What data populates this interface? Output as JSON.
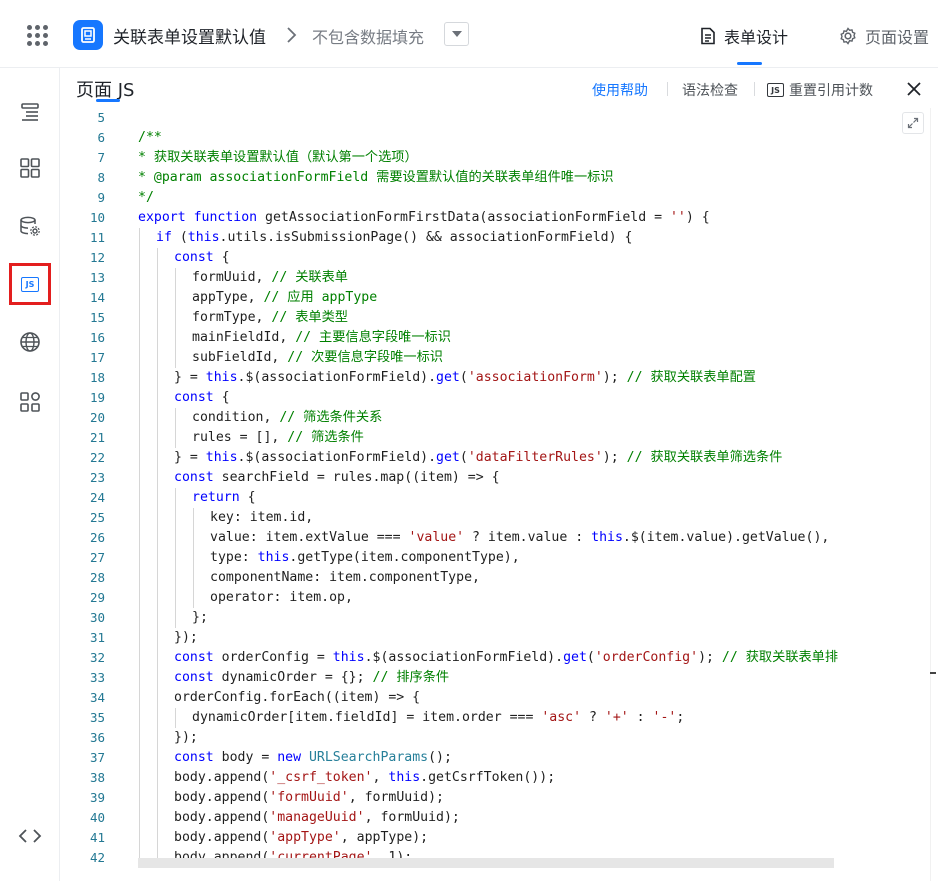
{
  "topbar": {
    "app_title": "关联表单设置默认值",
    "sub_title": "不包含数据填充",
    "nav_form": "表单设计",
    "nav_page": "页面设置"
  },
  "panel": {
    "title": "页面 JS",
    "help": "使用帮助",
    "lint": "语法检查",
    "reset": "重置引用计数",
    "js_badge": "JS"
  },
  "rail": {
    "js_badge": "JS"
  },
  "editor": {
    "lines": [
      {
        "n": "5",
        "indent": 0,
        "guides": [],
        "tokens": [
          [
            "",
            ""
          ]
        ]
      },
      {
        "n": "6",
        "indent": 0,
        "guides": [],
        "tokens": [
          [
            "cm",
            "/**"
          ]
        ]
      },
      {
        "n": "7",
        "indent": 0,
        "guides": [],
        "tokens": [
          [
            "cm",
            "* 获取关联表单设置默认值（默认第一个选项）"
          ]
        ]
      },
      {
        "n": "8",
        "indent": 0,
        "guides": [],
        "tokens": [
          [
            "cm",
            "* @param associationFormField 需要设置默认值的关联表单组件唯一标识"
          ]
        ]
      },
      {
        "n": "9",
        "indent": 0,
        "guides": [],
        "tokens": [
          [
            "cm",
            "*/"
          ]
        ]
      },
      {
        "n": "10",
        "indent": 0,
        "guides": [],
        "tokens": [
          [
            "kw",
            "export "
          ],
          [
            "kw",
            "function "
          ],
          [
            "fn",
            "getAssociationFormFirstData(associationFormField = "
          ],
          [
            "str",
            "''"
          ],
          [
            "fn",
            ") {"
          ]
        ]
      },
      {
        "n": "11",
        "indent": 1,
        "guides": [
          1
        ],
        "tokens": [
          [
            "kw",
            "if "
          ],
          [
            "fn",
            "("
          ],
          [
            "kw",
            "this"
          ],
          [
            "fn",
            ".utils.isSubmissionPage() && associationFormField) {"
          ]
        ]
      },
      {
        "n": "12",
        "indent": 2,
        "guides": [
          1,
          2
        ],
        "tokens": [
          [
            "kw",
            "const "
          ],
          [
            "fn",
            "{"
          ]
        ]
      },
      {
        "n": "13",
        "indent": 3,
        "guides": [
          1,
          2,
          3
        ],
        "tokens": [
          [
            "fn",
            "formUuid, "
          ],
          [
            "cm",
            "// 关联表单"
          ]
        ]
      },
      {
        "n": "14",
        "indent": 3,
        "guides": [
          1,
          2,
          3
        ],
        "tokens": [
          [
            "fn",
            "appType, "
          ],
          [
            "cm",
            "// 应用 appType"
          ]
        ]
      },
      {
        "n": "15",
        "indent": 3,
        "guides": [
          1,
          2,
          3
        ],
        "tokens": [
          [
            "fn",
            "formType, "
          ],
          [
            "cm",
            "// 表单类型"
          ]
        ]
      },
      {
        "n": "16",
        "indent": 3,
        "guides": [
          1,
          2,
          3
        ],
        "tokens": [
          [
            "fn",
            "mainFieldId, "
          ],
          [
            "cm",
            "// 主要信息字段唯一标识"
          ]
        ]
      },
      {
        "n": "17",
        "indent": 3,
        "guides": [
          1,
          2,
          3
        ],
        "tokens": [
          [
            "fn",
            "subFieldId, "
          ],
          [
            "cm",
            "// 次要信息字段唯一标识"
          ]
        ]
      },
      {
        "n": "18",
        "indent": 2,
        "guides": [
          1,
          2
        ],
        "tokens": [
          [
            "fn",
            "} = "
          ],
          [
            "kw",
            "this"
          ],
          [
            "fn",
            ".$(associationFormField)."
          ],
          [
            "kw",
            "get"
          ],
          [
            "fn",
            "("
          ],
          [
            "str",
            "'associationForm'"
          ],
          [
            "fn",
            "); "
          ],
          [
            "cm",
            "// 获取关联表单配置"
          ]
        ]
      },
      {
        "n": "19",
        "indent": 2,
        "guides": [
          1,
          2
        ],
        "tokens": [
          [
            "kw",
            "const "
          ],
          [
            "fn",
            "{"
          ]
        ]
      },
      {
        "n": "20",
        "indent": 3,
        "guides": [
          1,
          2,
          3
        ],
        "tokens": [
          [
            "fn",
            "condition, "
          ],
          [
            "cm",
            "// 筛选条件关系"
          ]
        ]
      },
      {
        "n": "21",
        "indent": 3,
        "guides": [
          1,
          2,
          3
        ],
        "tokens": [
          [
            "fn",
            "rules = [], "
          ],
          [
            "cm",
            "// 筛选条件"
          ]
        ]
      },
      {
        "n": "22",
        "indent": 2,
        "guides": [
          1,
          2
        ],
        "tokens": [
          [
            "fn",
            "} = "
          ],
          [
            "kw",
            "this"
          ],
          [
            "fn",
            ".$(associationFormField)."
          ],
          [
            "kw",
            "get"
          ],
          [
            "fn",
            "("
          ],
          [
            "str",
            "'dataFilterRules'"
          ],
          [
            "fn",
            "); "
          ],
          [
            "cm",
            "// 获取关联表单筛选条件"
          ]
        ]
      },
      {
        "n": "23",
        "indent": 2,
        "guides": [
          1,
          2
        ],
        "tokens": [
          [
            "kw",
            "const "
          ],
          [
            "fn",
            "searchField = rules.map((item) => {"
          ]
        ]
      },
      {
        "n": "24",
        "indent": 3,
        "guides": [
          1,
          2,
          3
        ],
        "tokens": [
          [
            "kw",
            "return "
          ],
          [
            "fn",
            "{"
          ]
        ]
      },
      {
        "n": "25",
        "indent": 4,
        "guides": [
          1,
          2,
          3,
          4
        ],
        "tokens": [
          [
            "fn",
            "key: item.id,"
          ]
        ]
      },
      {
        "n": "26",
        "indent": 4,
        "guides": [
          1,
          2,
          3,
          4
        ],
        "tokens": [
          [
            "fn",
            "value: item.extValue === "
          ],
          [
            "str",
            "'value'"
          ],
          [
            "fn",
            " ? item.value : "
          ],
          [
            "kw",
            "this"
          ],
          [
            "fn",
            ".$(item.value).getValue(),"
          ]
        ]
      },
      {
        "n": "27",
        "indent": 4,
        "guides": [
          1,
          2,
          3,
          4
        ],
        "tokens": [
          [
            "fn",
            "type: "
          ],
          [
            "kw",
            "this"
          ],
          [
            "fn",
            ".getType(item.componentType),"
          ]
        ]
      },
      {
        "n": "28",
        "indent": 4,
        "guides": [
          1,
          2,
          3,
          4
        ],
        "tokens": [
          [
            "fn",
            "componentName: item.componentType,"
          ]
        ]
      },
      {
        "n": "29",
        "indent": 4,
        "guides": [
          1,
          2,
          3,
          4
        ],
        "tokens": [
          [
            "fn",
            "operator: item.op,"
          ]
        ]
      },
      {
        "n": "30",
        "indent": 3,
        "guides": [
          1,
          2,
          3
        ],
        "tokens": [
          [
            "fn",
            "};"
          ]
        ]
      },
      {
        "n": "31",
        "indent": 2,
        "guides": [
          1,
          2
        ],
        "tokens": [
          [
            "fn",
            "});"
          ]
        ]
      },
      {
        "n": "32",
        "indent": 2,
        "guides": [
          1,
          2
        ],
        "tokens": [
          [
            "kw",
            "const "
          ],
          [
            "fn",
            "orderConfig = "
          ],
          [
            "kw",
            "this"
          ],
          [
            "fn",
            ".$(associationFormField)."
          ],
          [
            "kw",
            "get"
          ],
          [
            "fn",
            "("
          ],
          [
            "str",
            "'orderConfig'"
          ],
          [
            "fn",
            "); "
          ],
          [
            "cm",
            "// 获取关联表单排"
          ]
        ]
      },
      {
        "n": "33",
        "indent": 2,
        "guides": [
          1,
          2
        ],
        "tokens": [
          [
            "kw",
            "const "
          ],
          [
            "fn",
            "dynamicOrder = {}; "
          ],
          [
            "cm",
            "// 排序条件"
          ]
        ]
      },
      {
        "n": "34",
        "indent": 2,
        "guides": [
          1,
          2
        ],
        "tokens": [
          [
            "fn",
            "orderConfig.forEach((item) => {"
          ]
        ]
      },
      {
        "n": "35",
        "indent": 3,
        "guides": [
          1,
          2,
          3
        ],
        "tokens": [
          [
            "fn",
            "dynamicOrder[item.fieldId] = item.order === "
          ],
          [
            "str",
            "'asc'"
          ],
          [
            "fn",
            " ? "
          ],
          [
            "str",
            "'+'"
          ],
          [
            "fn",
            " : "
          ],
          [
            "str",
            "'-'"
          ],
          [
            "fn",
            ";"
          ]
        ]
      },
      {
        "n": "36",
        "indent": 2,
        "guides": [
          1,
          2
        ],
        "tokens": [
          [
            "fn",
            "});"
          ]
        ]
      },
      {
        "n": "37",
        "indent": 2,
        "guides": [
          1,
          2
        ],
        "tokens": [
          [
            "kw",
            "const "
          ],
          [
            "fn",
            "body = "
          ],
          [
            "kw",
            "new "
          ],
          [
            "cls",
            "URLSearchParams"
          ],
          [
            "fn",
            "();"
          ]
        ]
      },
      {
        "n": "38",
        "indent": 2,
        "guides": [
          1,
          2
        ],
        "tokens": [
          [
            "fn",
            "body.append("
          ],
          [
            "str",
            "'_csrf_token'"
          ],
          [
            "fn",
            ", "
          ],
          [
            "kw",
            "this"
          ],
          [
            "fn",
            ".getCsrfToken());"
          ]
        ]
      },
      {
        "n": "39",
        "indent": 2,
        "guides": [
          1,
          2
        ],
        "tokens": [
          [
            "fn",
            "body.append("
          ],
          [
            "str",
            "'formUuid'"
          ],
          [
            "fn",
            ", formUuid);"
          ]
        ]
      },
      {
        "n": "40",
        "indent": 2,
        "guides": [
          1,
          2
        ],
        "tokens": [
          [
            "fn",
            "body.append("
          ],
          [
            "str",
            "'manageUuid'"
          ],
          [
            "fn",
            ", formUuid);"
          ]
        ]
      },
      {
        "n": "41",
        "indent": 2,
        "guides": [
          1,
          2
        ],
        "tokens": [
          [
            "fn",
            "body.append("
          ],
          [
            "str",
            "'appType'"
          ],
          [
            "fn",
            ", appType);"
          ]
        ]
      },
      {
        "n": "42",
        "indent": 2,
        "guides": [
          1,
          2
        ],
        "tokens": [
          [
            "fn",
            "body.append("
          ],
          [
            "str",
            "'currentPage'"
          ],
          [
            "fn",
            ", 1);"
          ]
        ]
      }
    ]
  }
}
